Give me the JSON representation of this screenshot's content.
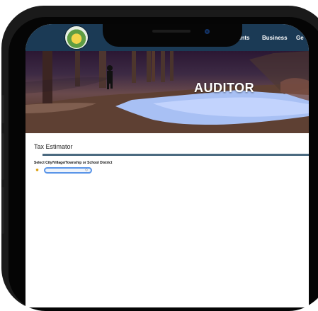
{
  "nav": {
    "items": [
      "ents",
      "Business",
      "Ge"
    ]
  },
  "hero": {
    "title": "AUDITOR"
  },
  "page": {
    "heading": "Tax Estimator"
  },
  "form": {
    "label": "Select City/Village/Township or School District",
    "help_icon": "help-icon",
    "select_value": ""
  },
  "colors": {
    "nav_bg": "#1b3a55",
    "rule": "#4b6a80",
    "select_border": "#5a95e8"
  }
}
